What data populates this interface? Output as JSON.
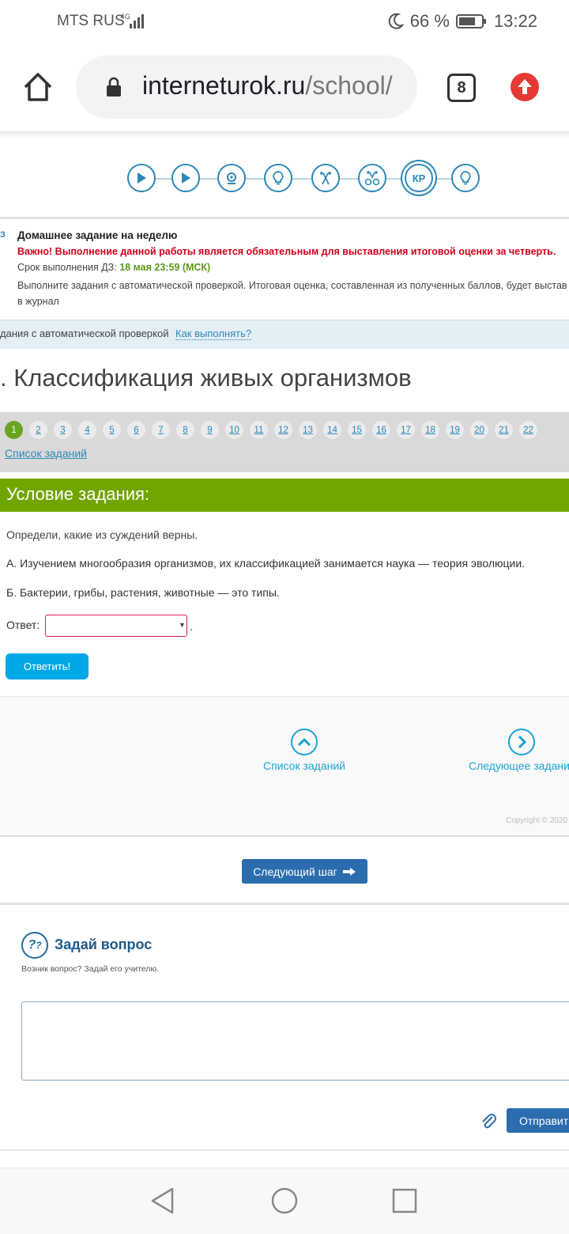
{
  "status_bar": {
    "carrier": "MTS RUS",
    "network": "4G",
    "battery": "66 %",
    "time": "13:22"
  },
  "browser": {
    "url_host": "interneturok.ru",
    "url_path": "/school/",
    "tabs_count": "8"
  },
  "lesson_steps": {
    "active_label": "КР"
  },
  "homework": {
    "tag": "ДЗ",
    "title": "Домашнее задание на неделю",
    "important": "Важно! Выполнение данной работы является обязательным для выставления итоговой оценки за четверть.",
    "deadline_label": "Срок выполнения ДЗ:",
    "deadline_value": "18 мая 23:59 (МСК)",
    "description_1": "Выполните задания с автоматической проверкой. Итоговая оценка, составленная из полученных баллов, будет выстав",
    "description_2": "в журнал"
  },
  "auto_bar": {
    "text": "дания с автоматической проверкой",
    "how_link": "Как выполнять?"
  },
  "lesson_title": ". Классификация живых организмов",
  "pager": {
    "pages": [
      "1",
      "2",
      "3",
      "4",
      "5",
      "6",
      "7",
      "8",
      "9",
      "10",
      "11",
      "12",
      "13",
      "14",
      "15",
      "16",
      "17",
      "18",
      "19",
      "20",
      "21",
      "22"
    ],
    "current": "1",
    "task_list_link": "Список заданий"
  },
  "task": {
    "header": "Условие задания:",
    "intro": "Определи, какие из суждений верны.",
    "statement_a": "А. Изучением многообразия организмов, их классификацией занимается наука — теория эволюции.",
    "statement_b": "Б. Бактерии, грибы, растения, животные — это типы.",
    "answer_label": "Ответ:",
    "answer_value": "",
    "answer_suffix": ".",
    "answer_button": "Ответить!"
  },
  "nav": {
    "task_list": "Список заданий",
    "next_task": "Следующее задание",
    "copyright": "Copyright © 2020"
  },
  "next_step_button": "Следующий шаг",
  "ask": {
    "title": "Задай вопрос",
    "subtitle": "Возник вопрос? Задай его учителю.",
    "icon_text": "?",
    "send_button": "Отправить"
  },
  "colors": {
    "accent_blue": "#2c89b8",
    "task_green": "#73a500",
    "important_red": "#d0021b",
    "button_blue": "#2b6cae"
  }
}
